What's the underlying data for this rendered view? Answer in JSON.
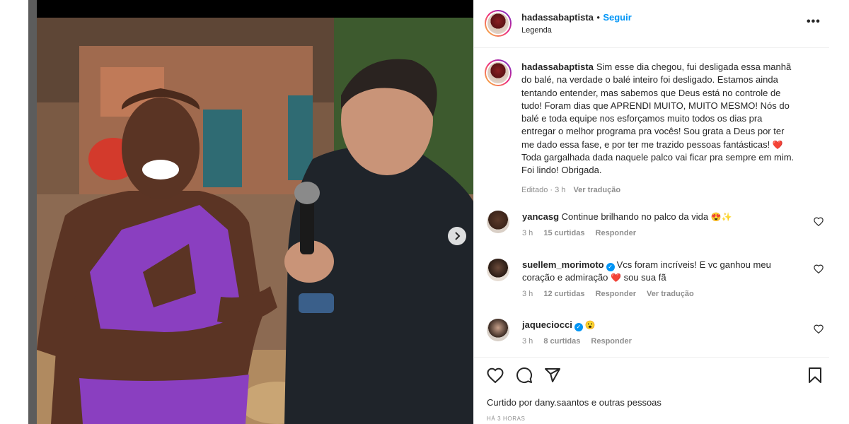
{
  "post": {
    "username": "hadassabaptista",
    "dot": "•",
    "follow_label": "Seguir",
    "subtitle": "Legenda",
    "more": "•••"
  },
  "caption": {
    "username": "hadassabaptista",
    "text": "Sim esse dia chegou, fui desligada essa manhã do balé, na verdade o balé inteiro foi desligado. Estamos ainda tentando entender, mas sabemos que Deus está no controle de tudo! Foram dias que APRENDI MUITO, MUITO MESMO! Nós do balé e toda equipe nos esforçamos muito todos os dias pra entregar o melhor programa pra vocês! Sou grata a Deus por ter me dado essa fase, e por ter me trazido pessoas fantásticas!",
    "heart": "❤️",
    "text2": "Toda gargalhada dada naquele palco vai ficar pra sempre em mim. Foi lindo! Obrigada.",
    "edited": "Editado · 3 h",
    "see_translation": "Ver tradução"
  },
  "comments": [
    {
      "username": "yancasg",
      "text": "Continue brilhando no palco da vida",
      "emoji": "😍✨",
      "time": "3 h",
      "likes": "15 curtidas",
      "reply": "Responder",
      "translate": ""
    },
    {
      "username": "suellem_morimoto",
      "verified": "✓",
      "text": "Vcs foram incríveis! E vc ganhou meu coração e admiração",
      "emoji": "❤️",
      "text_after": "sou sua fã",
      "time": "3 h",
      "likes": "12 curtidas",
      "reply": "Responder",
      "translate": "Ver tradução"
    },
    {
      "username": "jaqueciocci",
      "verified": "✓",
      "text": "",
      "emoji": "😮",
      "time": "3 h",
      "likes": "8 curtidas",
      "reply": "Responder",
      "translate": ""
    }
  ],
  "footer": {
    "liked_by": "Curtido por dany.saantos e outras pessoas",
    "time_ago": "HÁ 3 HORAS"
  },
  "icons": {
    "like": "heart-icon",
    "comment": "comment-icon",
    "share": "share-icon",
    "save": "bookmark-icon",
    "next": "chevron-right-icon",
    "more": "more-icon"
  },
  "colors": {
    "follow": "#0095f6",
    "muted": "#8e8e8e",
    "heart": "#e0245e",
    "verified": "#0095f6"
  }
}
